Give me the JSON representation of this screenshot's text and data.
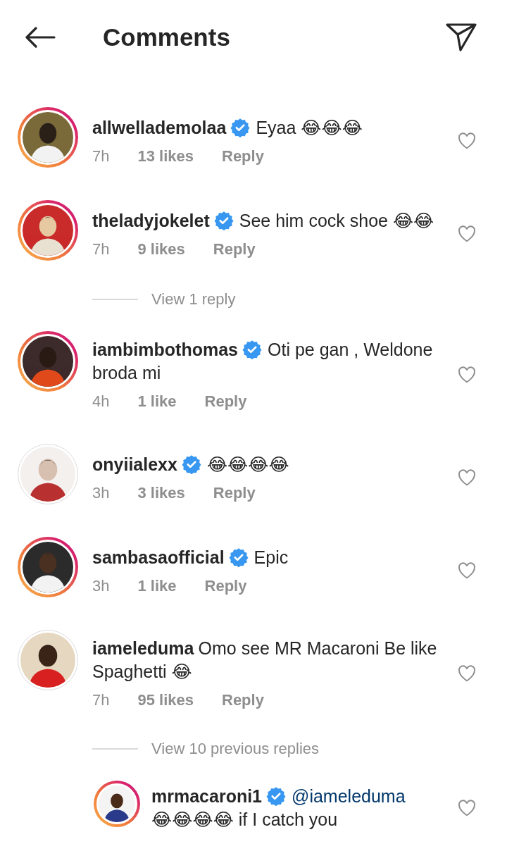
{
  "header": {
    "title": "Comments"
  },
  "comments": [
    {
      "username": "allwellademolaa",
      "verified": true,
      "story_ring": true,
      "text": "Eyaa 😂😂😂",
      "time": "7h",
      "likes": "13 likes",
      "reply": "Reply",
      "liked": false
    },
    {
      "username": "theladyjokelet",
      "verified": true,
      "story_ring": true,
      "text": "See him cock shoe 😂😂",
      "time": "7h",
      "likes": "9 likes",
      "reply": "Reply",
      "liked": false,
      "view_replies": "View 1 reply"
    },
    {
      "username": "iambimbothomas",
      "verified": true,
      "story_ring": true,
      "text": "Oti pe gan , Weldone broda mi",
      "time": "4h",
      "likes": "1 like",
      "reply": "Reply",
      "liked": false
    },
    {
      "username": "onyiialexx",
      "verified": true,
      "story_ring": false,
      "text": "😂😂😂😂",
      "time": "3h",
      "likes": "3 likes",
      "reply": "Reply",
      "liked": false
    },
    {
      "username": "sambasaofficial",
      "verified": true,
      "story_ring": true,
      "text": "Epic",
      "time": "3h",
      "likes": "1 like",
      "reply": "Reply",
      "liked": false
    },
    {
      "username": "iameleduma",
      "verified": false,
      "story_ring": false,
      "text": "Omo see MR Macaroni Be like Spaghetti 😂",
      "time": "7h",
      "likes": "95 likes",
      "reply": "Reply",
      "liked": false,
      "view_replies": "View 10 previous replies",
      "children": [
        {
          "username": "mrmacaroni1",
          "verified": true,
          "story_ring": true,
          "mention": "@iameleduma",
          "text": "😂😂😂😂 if I catch you",
          "liked": false
        }
      ]
    }
  ]
}
